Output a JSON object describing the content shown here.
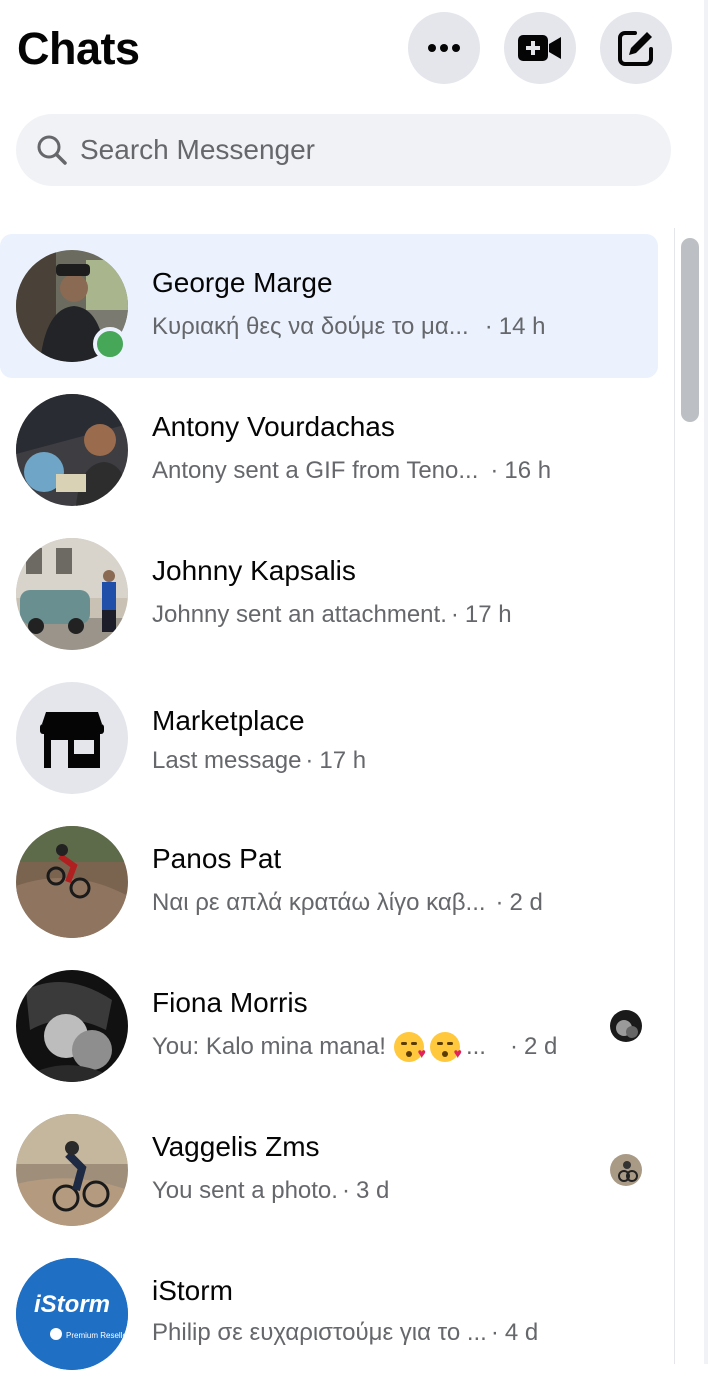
{
  "header": {
    "title": "Chats",
    "more_icon": "more-horizontal-icon",
    "video_icon": "video-call-icon",
    "compose_icon": "compose-icon"
  },
  "search": {
    "placeholder": "Search Messenger",
    "icon": "search-icon"
  },
  "colors": {
    "selected_row": "#ebf2fd",
    "online": "#46a758",
    "button_bg": "#e4e6eb",
    "search_bg": "#f0f2f5",
    "secondary_text": "#65676b"
  },
  "chats": [
    {
      "name": "George Marge",
      "preview": "Κυριακή θες να δούμε το μα...",
      "time": "14 h",
      "selected": true,
      "online": true
    },
    {
      "name": "Antony Vourdachas",
      "preview": "Antony sent a GIF from Teno...",
      "time": "16 h"
    },
    {
      "name": "Johnny Kapsalis",
      "preview": "Johnny sent an attachment.",
      "time": "17 h"
    },
    {
      "name": "Marketplace",
      "preview": "Last message",
      "time": "17 h",
      "icon": "marketplace-store-icon"
    },
    {
      "name": "Panos Pat",
      "preview": "Ναι ρε απλά κρατάω λίγο καβ...",
      "time": "2 d"
    },
    {
      "name": "Fiona Morris",
      "preview": "You: Kalo mina mana!",
      "preview_suffix": "...",
      "time": "2 d",
      "seen": true
    },
    {
      "name": "Vaggelis Zms",
      "preview": "You sent a photo.",
      "time": "3 d",
      "seen": true
    },
    {
      "name": "iStorm",
      "preview": "Philip σε ευχαριστούμε για το ...",
      "time": "4 d",
      "logo_text": "iStorm",
      "logo_sub": "Premium Reseller"
    }
  ]
}
